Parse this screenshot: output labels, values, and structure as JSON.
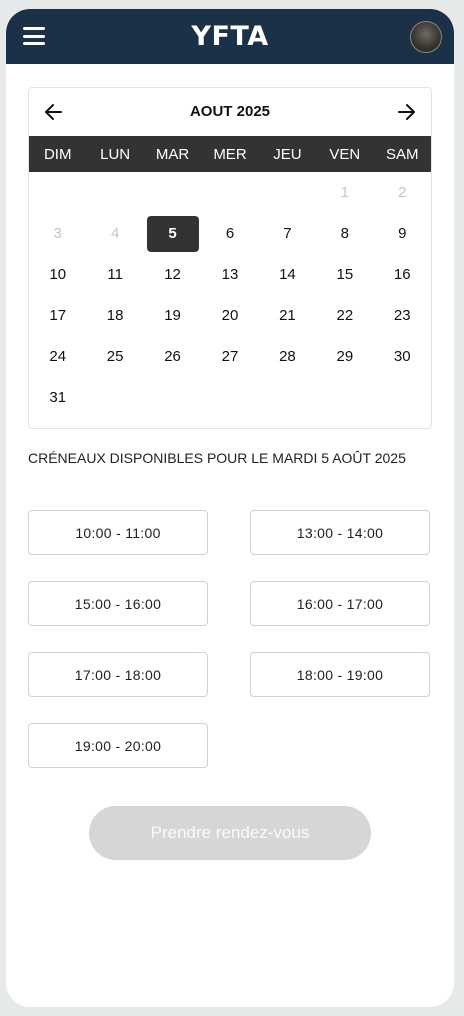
{
  "header": {
    "logo_text": "YFTA"
  },
  "calendar": {
    "month_label": "AOUT 2025",
    "weekdays": [
      "DIM",
      "LUN",
      "MAR",
      "MER",
      "JEU",
      "VEN",
      "SAM"
    ],
    "days": [
      {
        "label": "",
        "state": "empty"
      },
      {
        "label": "",
        "state": "empty"
      },
      {
        "label": "",
        "state": "empty"
      },
      {
        "label": "",
        "state": "empty"
      },
      {
        "label": "",
        "state": "empty"
      },
      {
        "label": "1",
        "state": "muted"
      },
      {
        "label": "2",
        "state": "muted"
      },
      {
        "label": "3",
        "state": "muted"
      },
      {
        "label": "4",
        "state": "muted"
      },
      {
        "label": "5",
        "state": "selected"
      },
      {
        "label": "6",
        "state": "active"
      },
      {
        "label": "7",
        "state": "active"
      },
      {
        "label": "8",
        "state": "active"
      },
      {
        "label": "9",
        "state": "active"
      },
      {
        "label": "10",
        "state": "active"
      },
      {
        "label": "11",
        "state": "active"
      },
      {
        "label": "12",
        "state": "active"
      },
      {
        "label": "13",
        "state": "active"
      },
      {
        "label": "14",
        "state": "active"
      },
      {
        "label": "15",
        "state": "active"
      },
      {
        "label": "16",
        "state": "active"
      },
      {
        "label": "17",
        "state": "active"
      },
      {
        "label": "18",
        "state": "active"
      },
      {
        "label": "19",
        "state": "active"
      },
      {
        "label": "20",
        "state": "active"
      },
      {
        "label": "21",
        "state": "active"
      },
      {
        "label": "22",
        "state": "active"
      },
      {
        "label": "23",
        "state": "active"
      },
      {
        "label": "24",
        "state": "active"
      },
      {
        "label": "25",
        "state": "active"
      },
      {
        "label": "26",
        "state": "active"
      },
      {
        "label": "27",
        "state": "active"
      },
      {
        "label": "28",
        "state": "active"
      },
      {
        "label": "29",
        "state": "active"
      },
      {
        "label": "30",
        "state": "active"
      },
      {
        "label": "31",
        "state": "active"
      }
    ]
  },
  "slots": {
    "title": "CRÉNEAUX DISPONIBLES POUR LE MARDI 5 AOÛT 2025",
    "items": [
      "10:00 - 11:00",
      "13:00 - 14:00",
      "15:00 - 16:00",
      "16:00 - 17:00",
      "17:00 - 18:00",
      "18:00 - 19:00",
      "19:00 - 20:00"
    ]
  },
  "cta": {
    "label": "Prendre rendez-vous",
    "enabled": false
  },
  "colors": {
    "topbar": "#1b3148",
    "selected_day": "#333333",
    "weekday_bar": "#333333",
    "cta_disabled": "#d6d6d6"
  },
  "icons": {
    "menu": "hamburger-icon",
    "prev": "arrow-left-icon",
    "next": "arrow-right-icon",
    "avatar": "user-avatar"
  }
}
